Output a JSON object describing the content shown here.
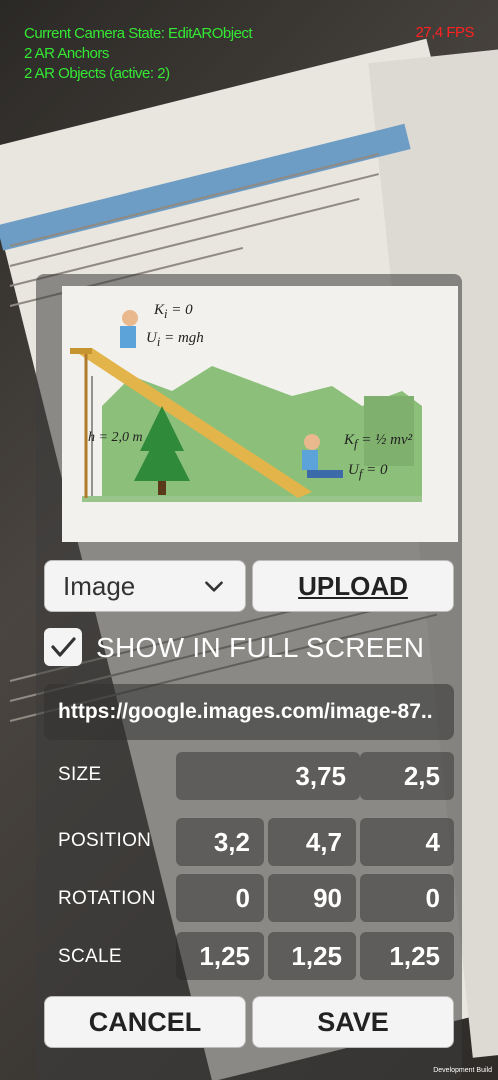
{
  "hud": {
    "camera_state": "Current Camera State: EditARObject",
    "anchors": "2 AR Anchors",
    "objects": "2 AR Objects (active: 2)",
    "fps": "27,4 FPS"
  },
  "preview": {
    "formula_top_k": "K",
    "formula_top_k_val": "= 0",
    "formula_top_u": "U",
    "formula_top_u_val": "= mgh",
    "height_label": "h = 2,0 m",
    "formula_bottom_k": "K",
    "formula_bottom_k_val": "= ½ mv²",
    "formula_bottom_u": "U",
    "formula_bottom_u_val": "= 0"
  },
  "type_select": {
    "value": "Image"
  },
  "upload_label": "UPLOAD",
  "fullscreen": {
    "label": "SHOW IN FULL SCREEN",
    "checked": true
  },
  "url": "https://google.images.com/image-87..",
  "transform": {
    "size": {
      "label": "SIZE",
      "values": [
        "3,75",
        "2,5"
      ]
    },
    "position": {
      "label": "POSITION",
      "values": [
        "3,2",
        "4,7",
        "4"
      ]
    },
    "rotation": {
      "label": "ROTATION",
      "values": [
        "0",
        "90",
        "0"
      ]
    },
    "scale": {
      "label": "SCALE",
      "values": [
        "1,25",
        "1,25",
        "1,25"
      ]
    }
  },
  "buttons": {
    "cancel": "CANCEL",
    "save": "SAVE"
  },
  "dev_build": "Development Build",
  "colors": {
    "hud_green": "#34e834",
    "fps_red": "#ff2222",
    "button_bg": "#f4f4f4"
  },
  "icons": {
    "dropdown": "chevron-down-icon",
    "checkbox": "checkmark-icon"
  }
}
